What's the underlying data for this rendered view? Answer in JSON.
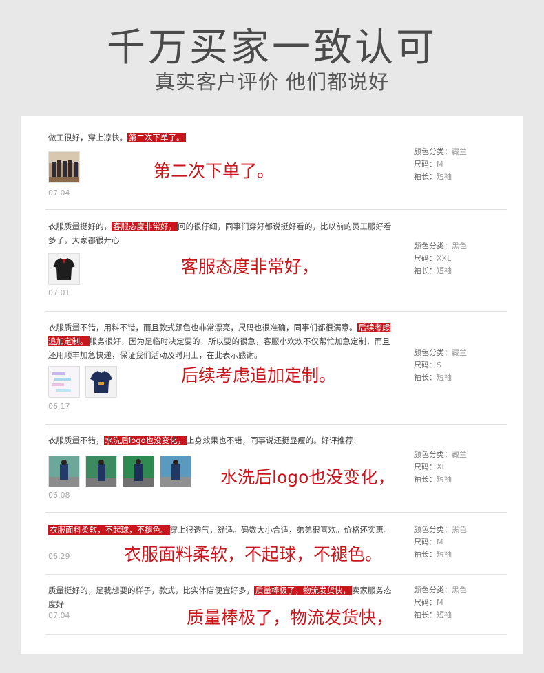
{
  "header": {
    "title": "千万买家一致认可",
    "subtitle": "真实客户评价 他们都说好"
  },
  "spec_labels": {
    "color": "颜色分类：",
    "size": "尺码：",
    "sleeve": "袖长："
  },
  "reviews": [
    {
      "text_before": "做工很好，穿上凉快。",
      "highlight": "第二次下单了。",
      "text_after": "",
      "big_caption": "第二次下单了。",
      "date": "07.04",
      "color": "藏兰",
      "size": "M",
      "sleeve": "短袖",
      "thumbs": [
        "group-photo"
      ]
    },
    {
      "text_before": "衣服质量挺好的，",
      "highlight": "客服态度非常好，",
      "text_after": "问的很仔细，同事们穿好都说挺好看的，比以前的员工服好看多了，大家都很开心",
      "big_caption": "客服态度非常好，",
      "date": "07.01",
      "color": "黑色",
      "size": "XXL",
      "sleeve": "短袖",
      "thumbs": [
        "black-polo"
      ]
    },
    {
      "text_before": "衣服质量不错，用料不错，而且款式颜色也非常漂亮，尺码也很准确，同事们都很满意。",
      "highlight": "后续考虑追加定制。",
      "text_after": "服务很好，因为是临时决定要的，所以要的很急，客服小欢欢不仅帮忙加急定制，而且还用顺丰加急快递，保证我们活动及时用上，在此表示感谢。",
      "big_caption": "后续考虑追加定制。",
      "date": "06.17",
      "color": "藏兰",
      "size": "S",
      "sleeve": "短袖",
      "thumbs": [
        "chat-screenshot",
        "navy-polo"
      ]
    },
    {
      "text_before": "衣服质量不错，",
      "highlight": "水洗后logo也没变化，",
      "text_after": "上身效果也不错，同事说还挺显瘦的。好评推荐！",
      "big_caption": "水洗后logo也没变化，",
      "date": "06.08",
      "color": "藏兰",
      "size": "XL",
      "sleeve": "短袖",
      "thumbs": [
        "worker-photo",
        "worker-photo",
        "worker-photo",
        "worker-photo"
      ]
    },
    {
      "text_before": "",
      "highlight": "衣服面料柔软，不起球，不褪色。",
      "text_after": "穿上很透气，舒适。码数大小合适，弟弟很喜欢。价格还实惠。",
      "big_caption": "衣服面料柔软，不起球，不褪色。",
      "date": "06.29",
      "color": "黑色",
      "size": "M",
      "sleeve": "短袖",
      "thumbs": []
    },
    {
      "text_before": "质量挺好的，是我想要的样子，款式，比实体店便宜好多，",
      "highlight": "质量棒极了，物流发货快，",
      "text_after": "卖家服务态度好",
      "big_caption": "质量棒极了，物流发货快，",
      "date": "07.04",
      "color": "黑色",
      "size": "M",
      "sleeve": "短袖",
      "thumbs": []
    }
  ]
}
